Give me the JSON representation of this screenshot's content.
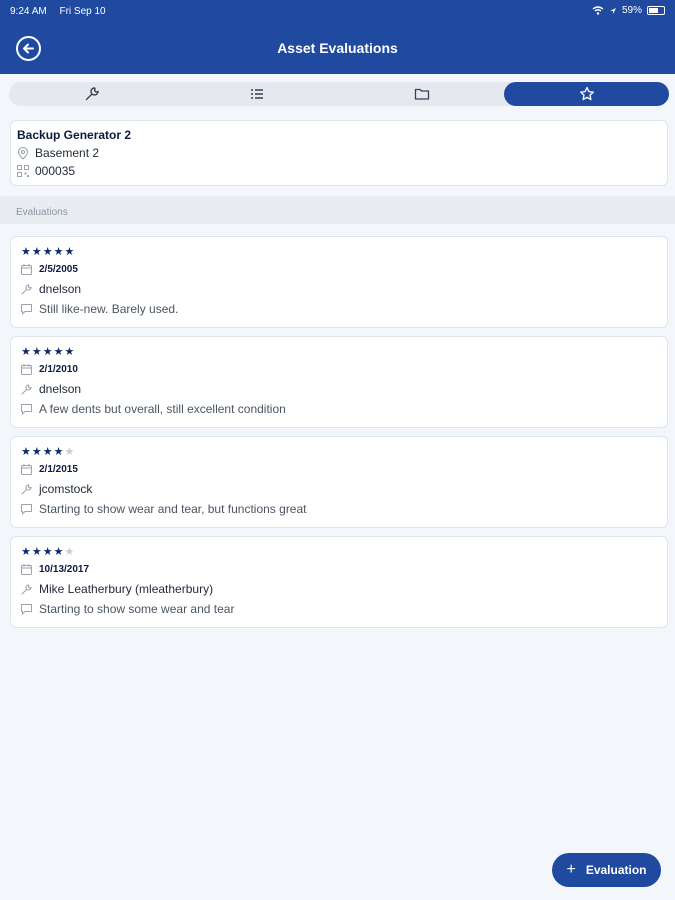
{
  "status": {
    "time": "9:24 AM",
    "date": "Fri Sep 10",
    "battery": "59%"
  },
  "header": {
    "title": "Asset Evaluations",
    "back_icon": "back-arrow-icon"
  },
  "tabs": [
    {
      "icon": "wrench-icon",
      "active": false
    },
    {
      "icon": "list-icon",
      "active": false
    },
    {
      "icon": "folder-icon",
      "active": false
    },
    {
      "icon": "star-icon",
      "active": true
    }
  ],
  "asset": {
    "name": "Backup Generator 2",
    "location": "Basement 2",
    "code": "000035"
  },
  "section": {
    "label": "Evaluations"
  },
  "evaluations": [
    {
      "rating": 5,
      "stars": "★★★★★",
      "date": "2/5/2005",
      "user": "dnelson",
      "comment": "Still like-new. Barely used."
    },
    {
      "rating": 5,
      "stars": "★★★★★",
      "date": "2/1/2010",
      "user": "dnelson",
      "comment": "A few dents but overall, still excellent condition"
    },
    {
      "rating": 4,
      "stars": "★★★★",
      "date": "2/1/2015",
      "user": "jcomstock",
      "comment": "Starting to show wear and tear, but functions great"
    },
    {
      "rating": 4,
      "stars": "★★★★",
      "date": "10/13/2017",
      "user": "Mike Leatherbury (mleatherbury)",
      "comment": "Starting to show some wear and tear"
    }
  ],
  "fab": {
    "label": "Evaluation",
    "icon": "plus-icon"
  },
  "colors": {
    "brand": "#1f4aa0",
    "background": "#f3f6fa",
    "star": "#0d2a6b"
  }
}
